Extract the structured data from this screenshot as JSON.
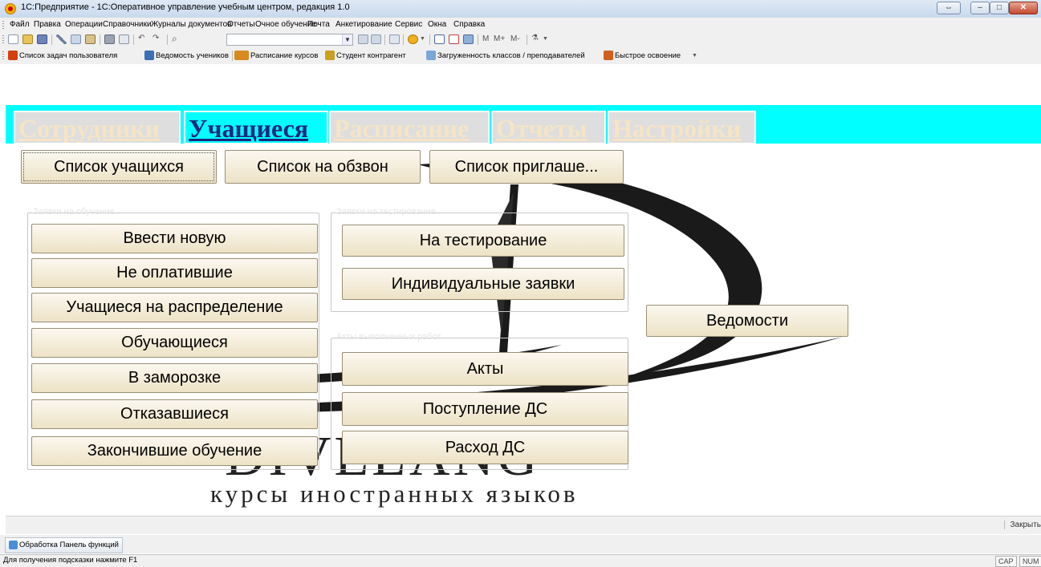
{
  "window": {
    "title": "1С:Предприятие - 1С:Оперативное управление учебным центром, редакция 1.0",
    "buttons": [
      "restore-down",
      "minimize",
      "maximize",
      "close"
    ]
  },
  "menu": {
    "items": [
      "Файл",
      "Правка",
      "Операции",
      "Справочники",
      "Журналы документов",
      "Отчеты",
      "Очное обучение",
      "Почта",
      "Анкетирование",
      "Сервис",
      "Окна",
      "Справка"
    ]
  },
  "toolbar": {
    "memory_buttons": [
      "M",
      "M+",
      "M-"
    ]
  },
  "quickbar": {
    "items": [
      {
        "label": "Список задач пользователя",
        "icon": "person-task-icon",
        "color": "#d04010"
      },
      {
        "label": "Ведомость учеников",
        "icon": "register-icon",
        "color": "#3a6fb5"
      },
      {
        "label": "Расписание курсов",
        "icon": "schedule-icon",
        "color": "#d88a20"
      },
      {
        "label": "Студент контрагент",
        "icon": "students-icon",
        "color": "#c9a020"
      },
      {
        "label": "Загруженность классов / преподавателей",
        "icon": "table-icon",
        "color": "#7aa6d8"
      },
      {
        "label": "Быстрое освоение",
        "icon": "quick-start-icon",
        "color": "#d06020"
      }
    ]
  },
  "tabs": [
    "Сотрудники",
    "Учащиеся",
    "Расписание",
    "Отчеты",
    "Настройки"
  ],
  "active_tab": "Учащиеся",
  "top_buttons": [
    "Список учащихся",
    "Список на обзвон",
    "Список приглаше..."
  ],
  "groups": {
    "applications": {
      "label": "Заявки на обучение",
      "buttons": [
        "Ввести новую",
        "Не оплатившие",
        "Учащиеся на распределение",
        "Обучающиеся",
        "В заморозке",
        "Отказавшиеся",
        "Закончившие обучение"
      ]
    },
    "testing": {
      "label": "Заявки на тестирование",
      "buttons": [
        "На тестирование",
        "Индивидуальные заявки"
      ]
    },
    "acts": {
      "label": "Акты выполненных работ",
      "buttons": [
        "Акты",
        "Поступление ДС",
        "Расход ДС"
      ]
    }
  },
  "vedomosti_button": "Ведомости",
  "logo": {
    "main": "DIVELANG",
    "subtitle": "курсы иностранных языков"
  },
  "close_panel": "Закрыть",
  "task_tab": "Обработка  Панель функций",
  "status": {
    "hint": "Для получения подсказки нажмите F1",
    "indicators": [
      "CAP",
      "NUM"
    ]
  }
}
